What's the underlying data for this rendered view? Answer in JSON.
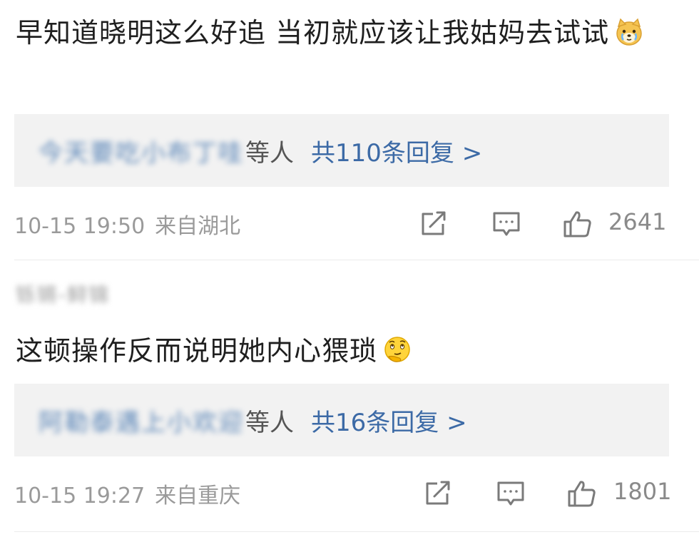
{
  "comments": [
    {
      "text": "早知道晓明这么好追 当初就应该让我姑妈去试试",
      "emoji": "crying-dog-emoji",
      "reply_preview": {
        "names": "今天要吃小布丁哇",
        "suffix": "等人",
        "count_text": "共110条回复 >"
      },
      "time": "10-15 19:50",
      "location": "来自湖北",
      "like_count": "2641"
    },
    {
      "username": "铄锵-鲟锦",
      "text": "这顿操作反而说明她内心猥琐",
      "emoji": "thinking-face-emoji",
      "reply_preview": {
        "names": "阿勒泰遇上小欢迎",
        "suffix": "等人",
        "count_text": "共16条回复 >"
      },
      "time": "10-15 19:27",
      "location": "来自重庆",
      "like_count": "1801"
    }
  ],
  "icons": {
    "repost": "repost-icon",
    "reply": "comment-icon",
    "like": "thumbs-up-icon"
  },
  "colors": {
    "link_blue": "#3c6aa6",
    "meta_gray": "#9a9a9a",
    "reply_bg": "#f2f2f2"
  }
}
